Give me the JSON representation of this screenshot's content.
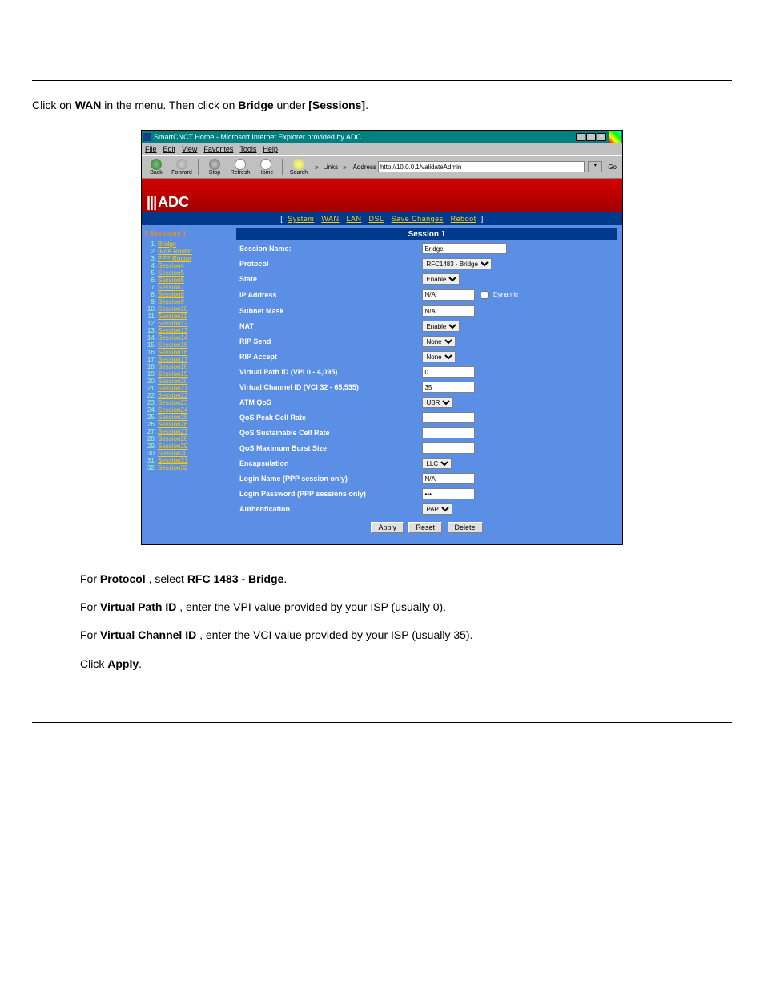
{
  "intro": {
    "wan": "WAN",
    "bridge": "Bridge",
    "sessions": "[Sessions]"
  },
  "ie": {
    "title": "SmartCNCT Home - Microsoft Internet Explorer provided by ADC",
    "menu": {
      "file": "File",
      "edit": "Edit",
      "view": "View",
      "favorites": "Favorites",
      "tools": "Tools",
      "help": "Help"
    },
    "tb": {
      "back": "Back",
      "forward": "Forward",
      "stop": "Stop",
      "refresh": "Refresh",
      "home": "Home",
      "search": "Search",
      "links": "Links",
      "address": "Address",
      "go": "Go"
    },
    "url": "http://10.0.0.1/validateAdmin"
  },
  "banner": {
    "brand": "ADC"
  },
  "topnav": {
    "system": "System",
    "wan": "WAN",
    "lan": "LAN",
    "dsl": "DSL",
    "save": "Save Changes",
    "reboot": "Reboot"
  },
  "sidebar": {
    "head": "[ Sessions ]",
    "items": [
      {
        "num": "1.",
        "label": "Bridge"
      },
      {
        "num": "2.",
        "label": "IPoA Router"
      },
      {
        "num": "3.",
        "label": "PPP Router"
      },
      {
        "num": "4.",
        "label": "Session4"
      },
      {
        "num": "5.",
        "label": "Session5"
      },
      {
        "num": "6.",
        "label": "Session6"
      },
      {
        "num": "7.",
        "label": "Session7"
      },
      {
        "num": "8.",
        "label": "Session8"
      },
      {
        "num": "9.",
        "label": "Session9"
      },
      {
        "num": "10.",
        "label": "Session10"
      },
      {
        "num": "11.",
        "label": "Session11"
      },
      {
        "num": "12.",
        "label": "Session12"
      },
      {
        "num": "13.",
        "label": "Session13"
      },
      {
        "num": "14.",
        "label": "Session14"
      },
      {
        "num": "15.",
        "label": "Session15"
      },
      {
        "num": "16.",
        "label": "Session16"
      },
      {
        "num": "17.",
        "label": "Session17"
      },
      {
        "num": "18.",
        "label": "Session18"
      },
      {
        "num": "19.",
        "label": "Session19"
      },
      {
        "num": "20.",
        "label": "Session20"
      },
      {
        "num": "21.",
        "label": "Session21"
      },
      {
        "num": "22.",
        "label": "Session22"
      },
      {
        "num": "23.",
        "label": "Session23"
      },
      {
        "num": "24.",
        "label": "Session24"
      },
      {
        "num": "25.",
        "label": "Session25"
      },
      {
        "num": "26.",
        "label": "Session26"
      },
      {
        "num": "27.",
        "label": "Session27"
      },
      {
        "num": "28.",
        "label": "Session28"
      },
      {
        "num": "29.",
        "label": "Session29"
      },
      {
        "num": "30.",
        "label": "Session30"
      },
      {
        "num": "31.",
        "label": "Session31"
      },
      {
        "num": "32.",
        "label": "Session32"
      }
    ]
  },
  "session": {
    "title": "Session 1",
    "labels": {
      "name": "Session Name:",
      "protocol": "Protocol",
      "state": "State",
      "ip": "IP Address",
      "mask": "Subnet Mask",
      "nat": "NAT",
      "ripsend": "RIP Send",
      "ripaccept": "RIP Accept",
      "vpi": "Virtual Path ID (VPI  0 - 4,095)",
      "vci": "Virtual Channel ID (VCI 32 - 65,535)",
      "atmqos": "ATM QoS",
      "peak": "QoS Peak Cell Rate",
      "sustain": "QoS Sustainable Cell Rate",
      "burst": "QoS Maximum Burst Size",
      "encap": "Encapsulation",
      "login": "Login Name (PPP session only)",
      "password": "Login Password (PPP sessions only)",
      "auth": "Authentication"
    },
    "values": {
      "name": "Bridge",
      "protocol": "RFC1483 - Bridge",
      "state": "Enable",
      "ip": "N/A",
      "dynamic": "Dynamic",
      "mask": "N/A",
      "nat": "Enable",
      "ripsend": "None",
      "ripaccept": "None",
      "vpi": "0",
      "vci": "35",
      "atmqos": "UBR",
      "peak": "",
      "sustain": "",
      "burst": "",
      "encap": "LLC",
      "login": "N/A",
      "password": "***",
      "auth": "PAP"
    },
    "buttons": {
      "apply": "Apply",
      "reset": "Reset",
      "delete": "Delete"
    }
  },
  "steps": {
    "protocol_lbl": "Protocol",
    "protocol_val": "RFC 1483 - Bridge",
    "vpi": "Virtual Path ID",
    "vci": "Virtual Channel ID",
    "apply": "Apply"
  }
}
